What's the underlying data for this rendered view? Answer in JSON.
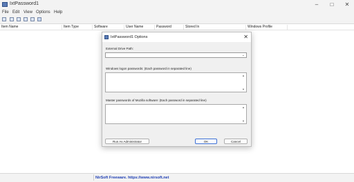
{
  "window": {
    "title": "IxtPassword1"
  },
  "menu": [
    "File",
    "Edit",
    "View",
    "Options",
    "Help"
  ],
  "toolbar": {
    "icons": [
      "save-icon",
      "html-report-icon",
      "copy-icon",
      "options-icon",
      "properties-icon",
      "about-icon"
    ]
  },
  "columns": [
    "Item Name",
    "Item Type",
    "Software",
    "User Name",
    "Password",
    "Stored In",
    "Windows Profile"
  ],
  "status": {
    "text": "NirSoft Freeware. https://www.nirsoft.net"
  },
  "dialog": {
    "title": "IxtPassword1 Options",
    "close": "✕",
    "external_drive_label": "External Drive Path:",
    "external_drive_value": "",
    "windows_logon_label": "Windows logon passwords: (Each password in separated line)",
    "windows_logon_value": "",
    "mozilla_label": "Master passwords of Mozilla software: (Each password in separated line)",
    "mozilla_value": "",
    "run_admin": "Run As Administrator",
    "ok": "OK",
    "cancel": "Cancel"
  },
  "colors": {
    "link": "#1f3fb3",
    "accent": "#3b6fd6"
  }
}
